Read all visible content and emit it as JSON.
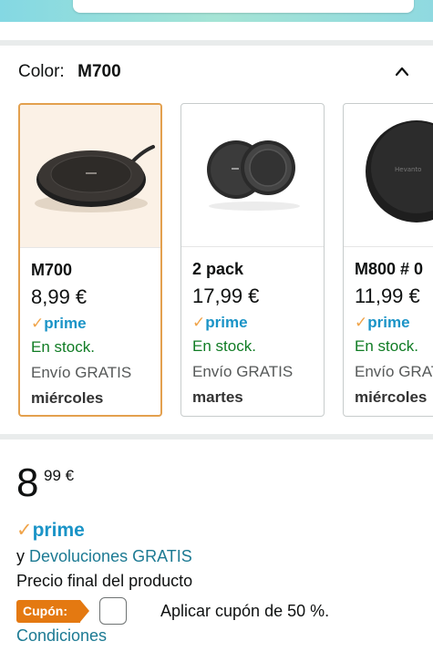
{
  "color_selector": {
    "label": "Color:",
    "selected": "M700"
  },
  "variants": [
    {
      "name": "M700",
      "price": "8,99 €",
      "prime": "prime",
      "stock": "En stock.",
      "shipping": "Envío GRATIS",
      "day": "miércoles",
      "selected": true
    },
    {
      "name": "2 pack",
      "price": "17,99 €",
      "prime": "prime",
      "stock": "En stock.",
      "shipping": "Envío GRATIS",
      "day": "martes",
      "selected": false
    },
    {
      "name": "M800 # 0",
      "price": "11,99 €",
      "prime": "prime",
      "stock": "En stock.",
      "shipping": "Envío GRATIS",
      "day": "miércoles",
      "selected": false
    }
  ],
  "price": {
    "integer": "8",
    "fraction_currency": "99 €"
  },
  "prime_label": "prime",
  "returns": {
    "prefix": "y",
    "link": "Devoluciones GRATIS"
  },
  "final_price_note": "Precio final del producto",
  "coupon": {
    "badge": "Cupón:",
    "text": "Aplicar cupón de 50 %.",
    "checked": false
  },
  "conditions_link": "Condiciones",
  "colors": {
    "prime_blue": "#1b94c7",
    "prime_check": "#f0a44a",
    "in_stock_green": "#107c24",
    "link": "#1c7a93",
    "coupon_orange": "#e47911",
    "selected_border": "#e3a04e"
  }
}
